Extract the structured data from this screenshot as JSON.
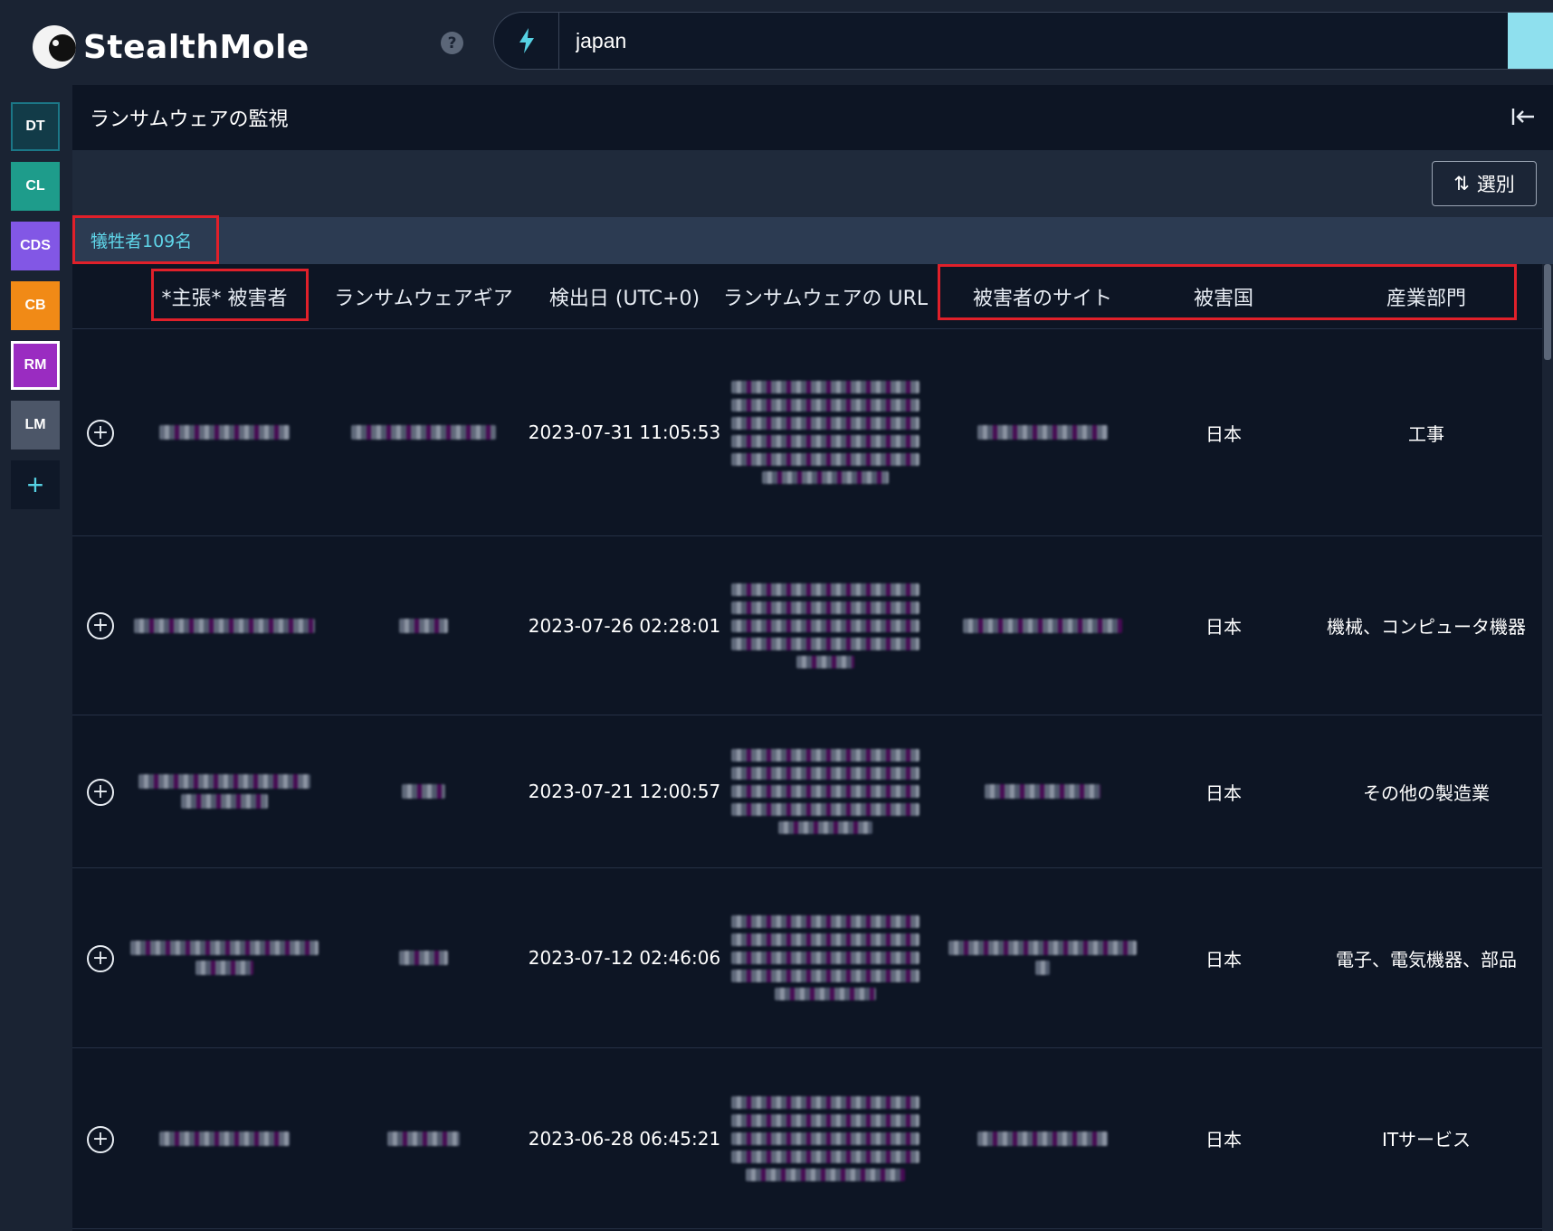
{
  "app": {
    "name": "StealthMole"
  },
  "search": {
    "value": "japan"
  },
  "left_nav": [
    {
      "label": "DT"
    },
    {
      "label": "CL"
    },
    {
      "label": "CDS"
    },
    {
      "label": "CB"
    },
    {
      "label": "RM"
    },
    {
      "label": "LM"
    },
    {
      "label": "+"
    }
  ],
  "panel": {
    "title": "ランサムウェアの監視",
    "sort_label": "選別",
    "victim_count": "犠牲者109名"
  },
  "table": {
    "columns": [
      "*主張* 被害者",
      "ランサムウェアギア",
      "検出日 (UTC+0)",
      "ランサムウェアの URL",
      "被害者のサイト",
      "被害国",
      "産業部門"
    ],
    "rows": [
      {
        "date": "2023-07-31 11:05:53",
        "country": "日本",
        "sector": "工事"
      },
      {
        "date": "2023-07-26 02:28:01",
        "country": "日本",
        "sector": "機械、コンピュータ機器"
      },
      {
        "date": "2023-07-21 12:00:57",
        "country": "日本",
        "sector": "その他の製造業"
      },
      {
        "date": "2023-07-12 02:46:06",
        "country": "日本",
        "sector": "電子、電気機器、部品"
      },
      {
        "date": "2023-06-28 06:45:21",
        "country": "日本",
        "sector": "ITサービス"
      }
    ]
  },
  "colors": {
    "accent": "#5fd5e8",
    "highlight": "#e0202a",
    "background": "#0d1524"
  }
}
